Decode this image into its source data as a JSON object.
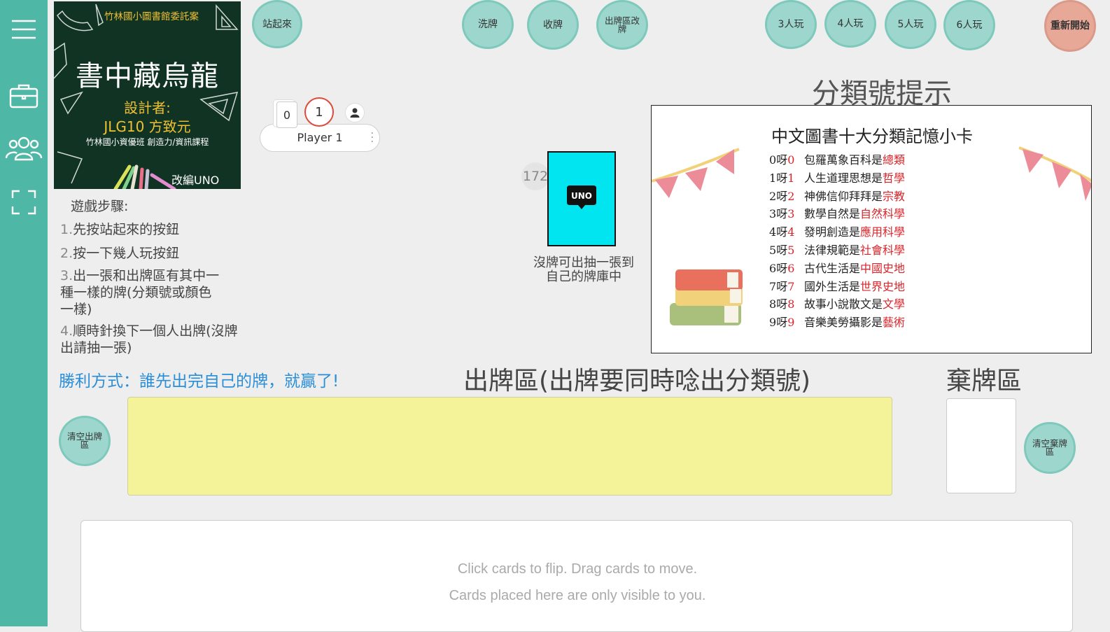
{
  "sidebar": {
    "icons": [
      "menu-icon",
      "briefcase-icon",
      "users-icon",
      "fullscreen-icon"
    ]
  },
  "poster": {
    "line1": "竹林國小圖書館委託案",
    "title": "書中藏烏龍",
    "designer_label": "設計者:",
    "designer": "JLG10 方致元",
    "school": "竹林國小資優班 創造力/資訊課程",
    "footer": "改編UNO"
  },
  "buttons": {
    "stand_up": "站起來",
    "shuffle": "洗牌",
    "collect": "收牌",
    "change_play_area": "出牌區改牌",
    "p3": "3人玩",
    "p4": "4人玩",
    "p5": "5人玩",
    "p6": "6人玩",
    "restart": "重新開始",
    "clear_play": "清空出牌區",
    "clear_discard": "清空棄牌區"
  },
  "player": {
    "hand_count": "0",
    "score": "1",
    "name": "Player 1"
  },
  "instructions": {
    "heading": "遊戲步驟:",
    "step1_num": "1.",
    "step1": "先按站起來的按鈕",
    "step2_num": "2.",
    "step2": "按一下幾人玩按鈕",
    "step3_num": "3.",
    "step3_a": "出一張和出牌區有其中一",
    "step3_b": "種一樣的牌(分類號或顏色",
    "step3_c": "一樣)",
    "step4_num": "4.",
    "step4_a": "順時針換下一個人出牌(沒牌",
    "step4_b": "出請抽一張)",
    "win": "勝利方式：誰先出完自己的牌，就贏了!"
  },
  "deck": {
    "count": "172",
    "logo": "UNO",
    "caption_a": "沒牌可出抽一張到",
    "caption_b": "自己的牌庫中"
  },
  "hint": {
    "title": "分類號提示",
    "heading": "中文圖書十大分類記憶小卡",
    "rows": [
      {
        "n": "0",
        "label": "0",
        "text": "包羅萬象百科是",
        "sub": "總類"
      },
      {
        "n": "1",
        "label": "1",
        "text": "人生道理思想是",
        "sub": "哲學"
      },
      {
        "n": "2",
        "label": "2",
        "text": "神佛信仰拜拜是",
        "sub": "宗教"
      },
      {
        "n": "3",
        "label": "3",
        "text": "數學自然是",
        "sub": "自然科學"
      },
      {
        "n": "4",
        "label": "4",
        "text": "發明創造是",
        "sub": "應用科學"
      },
      {
        "n": "5",
        "label": "5",
        "text": "法律規範是",
        "sub": "社會科學"
      },
      {
        "n": "6",
        "label": "6",
        "text": "古代生活是",
        "sub": "中國史地"
      },
      {
        "n": "7",
        "label": "7",
        "text": "國外生活是",
        "sub": "世界史地"
      },
      {
        "n": "8",
        "label": "8",
        "text": "故事小說散文是",
        "sub": "文學"
      },
      {
        "n": "9",
        "label": "9",
        "text": "音樂美勞攝影是",
        "sub": "藝術"
      }
    ],
    "ya": "呀"
  },
  "areas": {
    "play_title": "出牌區(出牌要同時唸出分類號)",
    "discard_title": "棄牌區"
  },
  "hand": {
    "hint1": "Click cards to flip.   Drag cards to move.",
    "hint2": "Cards placed here are only visible to you."
  },
  "colors": {
    "sidebar": "#4fb7a6",
    "button": "#9cd6cc",
    "restart": "#e8a898",
    "play_area": "#f5f399",
    "uno_card": "#00e5f0",
    "win_text": "#2a8ed8",
    "hint_red": "#d8242a"
  }
}
